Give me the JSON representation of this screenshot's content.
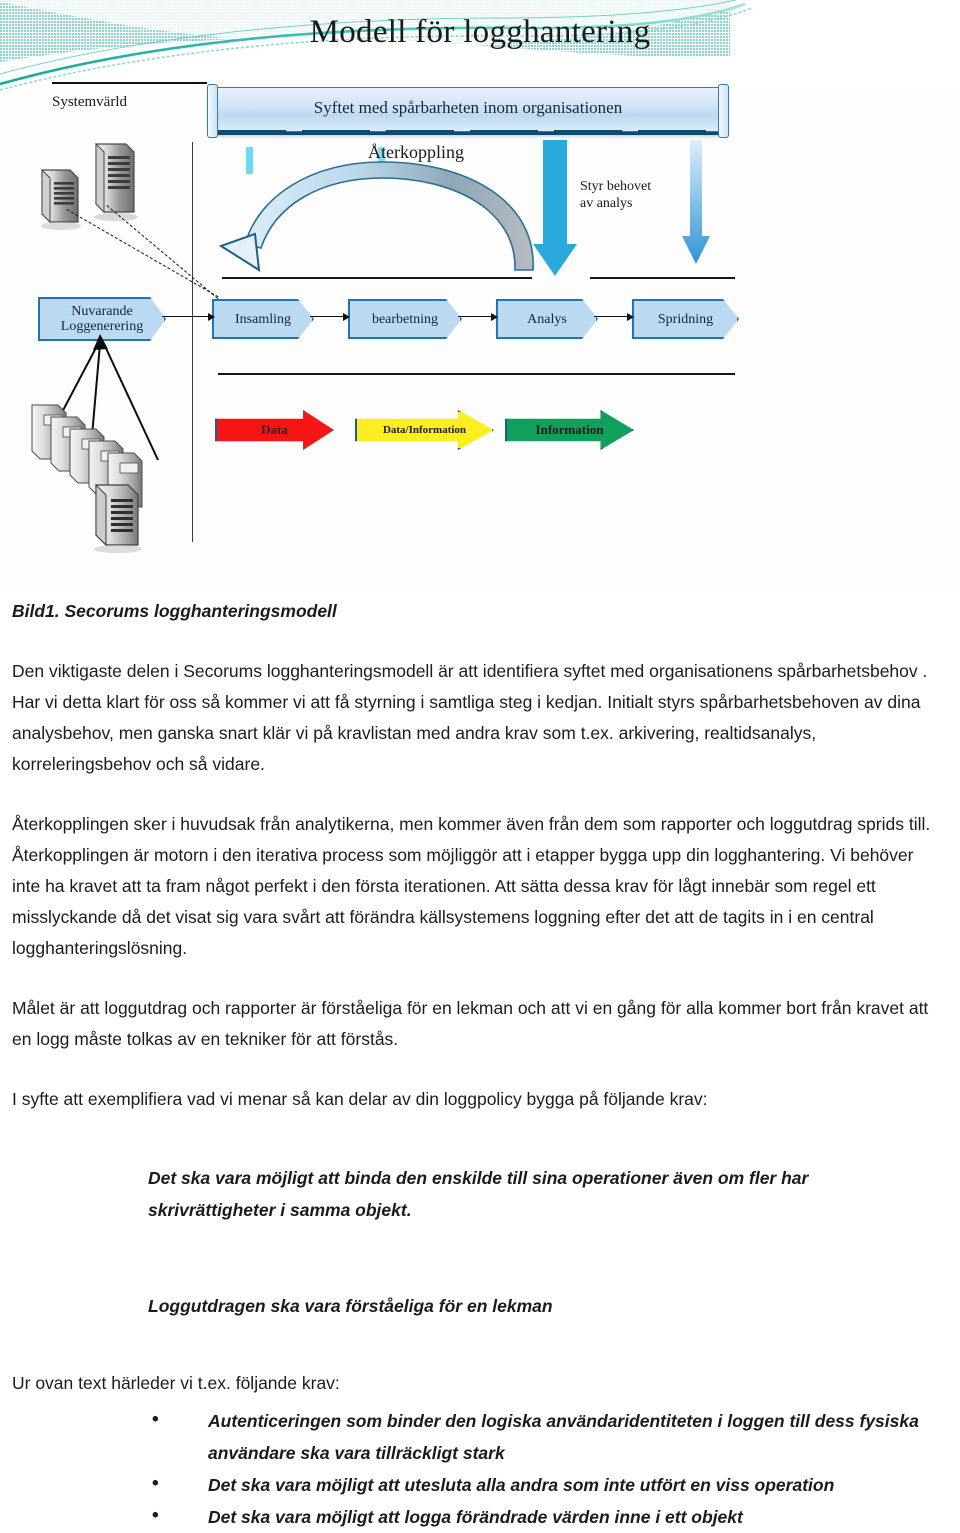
{
  "header": {
    "title": "Modell för logghantering",
    "accent_color": "#2bb3ac",
    "accent_color_2": "#7fd8d0"
  },
  "diagram": {
    "systemvarld_label": "Systemvärld",
    "banner_label": "Syftet med spårbarheten inom organisationen",
    "aterkoppling_label": "Återkoppling",
    "styr_behovet_label": "Styr behovet\nav analys",
    "process_steps": [
      {
        "label": "Nuvarande\nLoggenerering"
      },
      {
        "label": "Insamling"
      },
      {
        "label": "bearbetning"
      },
      {
        "label": "Analys"
      },
      {
        "label": "Spridning"
      }
    ],
    "data_arrows": [
      {
        "label": "Data",
        "color": "#f51515"
      },
      {
        "label": "Data/Information",
        "color": "#fcee21"
      },
      {
        "label": "Information",
        "color": "#11a05c"
      }
    ]
  },
  "content": {
    "caption": "Bild1. Secorums logghanteringsmodell",
    "paragraph_1": "Den viktigaste delen i Secorums logghanteringsmodell är att identifiera syftet med organisationens spårbarhetsbehov . Har vi detta klart för oss så kommer vi att få styrning i samtliga steg i kedjan. Initialt styrs spårbarhetsbehoven av dina analysbehov, men ganska snart klär vi på kravlistan med andra krav som t.ex. arkivering, realtidsanalys, korreleringsbehov och så vidare.",
    "paragraph_2": "Återkopplingen sker i huvudsak från analytikerna, men kommer även från dem som rapporter och loggutdrag sprids till. Återkopplingen är motorn i den iterativa process som möjliggör att i etapper bygga upp din logghantering. Vi behöver inte ha kravet att ta fram något perfekt i den första iterationen. Att sätta dessa krav för lågt innebär som regel ett misslyckande då det visat sig vara svårt att förändra källsystemens loggning efter det att de tagits in i en central logghanteringslösning.",
    "paragraph_3": "Målet är att loggutdrag och rapporter är förståeliga för en lekman och att vi en gång för alla kommer bort från kravet att en logg måste tolkas av en tekniker för att förstås.",
    "paragraph_4": "I syfte att exemplifiera vad vi menar så kan delar av din loggpolicy bygga på följande krav:",
    "quote_1": "Det ska vara möjligt att binda den enskilde till sina operationer även om fler har skrivrättigheter i samma objekt.",
    "quote_2": "Loggutdragen ska vara förståeliga för en lekman",
    "paragraph_5": "Ur ovan text härleder vi t.ex. följande krav:",
    "krav_items": [
      "Autenticeringen som binder den logiska användaridentiteten i loggen till dess fysiska användare ska vara tillräckligt stark",
      "Det ska vara möjligt att utesluta alla andra som inte utfört en viss operation",
      "Det ska vara möjligt att logga förändrade värden inne i ett objekt"
    ]
  }
}
